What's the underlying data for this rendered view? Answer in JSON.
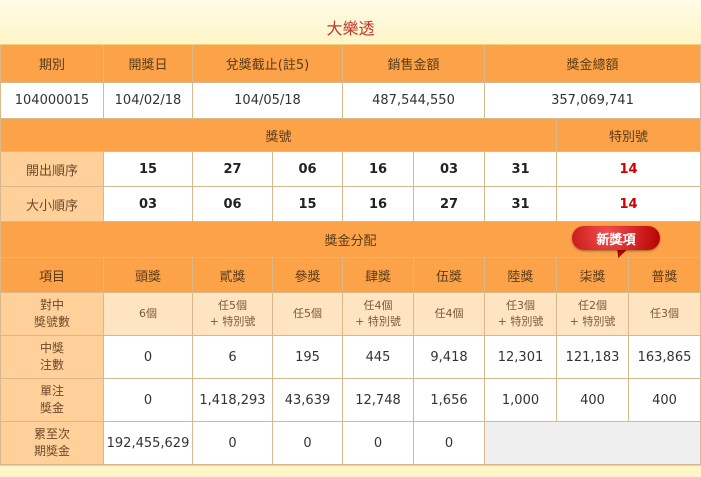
{
  "title": "大樂透",
  "header": {
    "labels": [
      "期別",
      "開獎日",
      "兌獎截止(註5)",
      "銷售金額",
      "獎金總額"
    ],
    "values": [
      "104000015",
      "104/02/18",
      "104/05/18",
      "487,544,550",
      "357,069,741"
    ]
  },
  "numbers": {
    "main_label": "獎號",
    "special_label": "特別號",
    "draw_order_label": "開出順序",
    "draw_order": [
      "15",
      "27",
      "06",
      "16",
      "03",
      "31"
    ],
    "draw_order_special": "14",
    "size_order_label": "大小順序",
    "size_order": [
      "03",
      "06",
      "15",
      "16",
      "27",
      "31"
    ],
    "size_order_special": "14"
  },
  "prize": {
    "section_label": "獎金分配",
    "new_badge": "新獎項",
    "item_label": "項目",
    "tiers": [
      "頭獎",
      "貳獎",
      "參獎",
      "肆獎",
      "伍獎",
      "陸獎",
      "柒獎",
      "普獎"
    ],
    "match_label": [
      "對中",
      "獎號數"
    ],
    "match": [
      [
        "6個",
        ""
      ],
      [
        "任5個",
        "+ 特別號"
      ],
      [
        "任5個",
        ""
      ],
      [
        "任4個",
        "+ 特別號"
      ],
      [
        "任4個",
        ""
      ],
      [
        "任3個",
        "+ 特別號"
      ],
      [
        "任2個",
        "+ 特別號"
      ],
      [
        "任3個",
        ""
      ]
    ],
    "winners_label": [
      "中獎",
      "注數"
    ],
    "winners": [
      "0",
      "6",
      "195",
      "445",
      "9,418",
      "12,301",
      "121,183",
      "163,865"
    ],
    "amount_label": [
      "單注",
      "獎金"
    ],
    "amount": [
      "0",
      "1,418,293",
      "43,639",
      "12,748",
      "1,656",
      "1,000",
      "400",
      "400"
    ],
    "rollover_label": [
      "累至次",
      "期獎金"
    ],
    "rollover": [
      "192,455,629",
      "0",
      "0",
      "0",
      "0"
    ]
  },
  "colors": {
    "header_bg": "#fca349",
    "label_bg": "#ffd09a",
    "special_number": "#cc0000",
    "badge": "#cc0000"
  }
}
